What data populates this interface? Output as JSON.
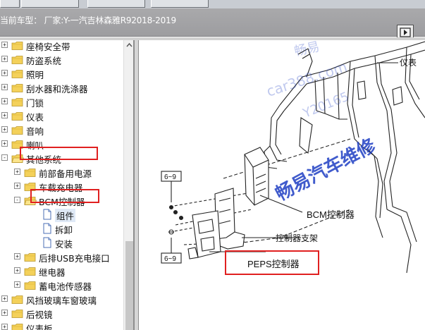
{
  "header": {
    "vehicle_label": "当前车型： 厂家:Y-一汽吉林森雅R92018-2019"
  },
  "tree": {
    "items": [
      {
        "label": "座椅安全带",
        "expander": "+",
        "type": "folder",
        "level": 0
      },
      {
        "label": "防盗系统",
        "expander": "+",
        "type": "folder",
        "level": 0
      },
      {
        "label": "照明",
        "expander": "+",
        "type": "folder",
        "level": 0
      },
      {
        "label": "刮水器和洗涤器",
        "expander": "+",
        "type": "folder",
        "level": 0
      },
      {
        "label": "门锁",
        "expander": "+",
        "type": "folder",
        "level": 0
      },
      {
        "label": "仪表",
        "expander": "+",
        "type": "folder",
        "level": 0
      },
      {
        "label": "音响",
        "expander": "+",
        "type": "folder",
        "level": 0
      },
      {
        "label": "喇叭",
        "expander": "+",
        "type": "folder",
        "level": 0
      },
      {
        "label": "其他系统",
        "expander": "-",
        "type": "folder-open",
        "level": 0
      },
      {
        "label": "前部备用电源",
        "expander": "+",
        "type": "folder",
        "level": 1
      },
      {
        "label": "车载充电器",
        "expander": "+",
        "type": "folder",
        "level": 1
      },
      {
        "label": "BCM控制器",
        "expander": "-",
        "type": "folder-open",
        "level": 1
      },
      {
        "label": "组件",
        "expander": "",
        "type": "doc",
        "level": 2,
        "selected": true
      },
      {
        "label": "拆卸",
        "expander": "",
        "type": "doc",
        "level": 2
      },
      {
        "label": "安装",
        "expander": "",
        "type": "doc",
        "level": 2
      },
      {
        "label": "后排USB充电接口",
        "expander": "+",
        "type": "folder",
        "level": 1
      },
      {
        "label": "继电器",
        "expander": "+",
        "type": "folder",
        "level": 1
      },
      {
        "label": "蓄电池传感器",
        "expander": "+",
        "type": "folder",
        "level": 1
      },
      {
        "label": "风挡玻璃车窗玻璃",
        "expander": "+",
        "type": "folder",
        "level": 0
      },
      {
        "label": "后视镜",
        "expander": "+",
        "type": "folder",
        "level": 0
      },
      {
        "label": "仪表板",
        "expander": "+",
        "type": "folder",
        "level": 0
      }
    ]
  },
  "diagram": {
    "labels": {
      "instrument": "仪表",
      "ref_top": "6~9",
      "ref_bottom": "6~9",
      "bcm": "BCM控制器",
      "bracket": "控制器支架",
      "peps": "PEPS控制器"
    },
    "watermark": {
      "line1": "畅易",
      "line2": "car388.com",
      "line3": "Y20165",
      "line4": "畅易汽车维修"
    }
  },
  "colors": {
    "highlight": "#e02020",
    "watermark": "#1f3fc4",
    "folder": "#f4d15a"
  }
}
